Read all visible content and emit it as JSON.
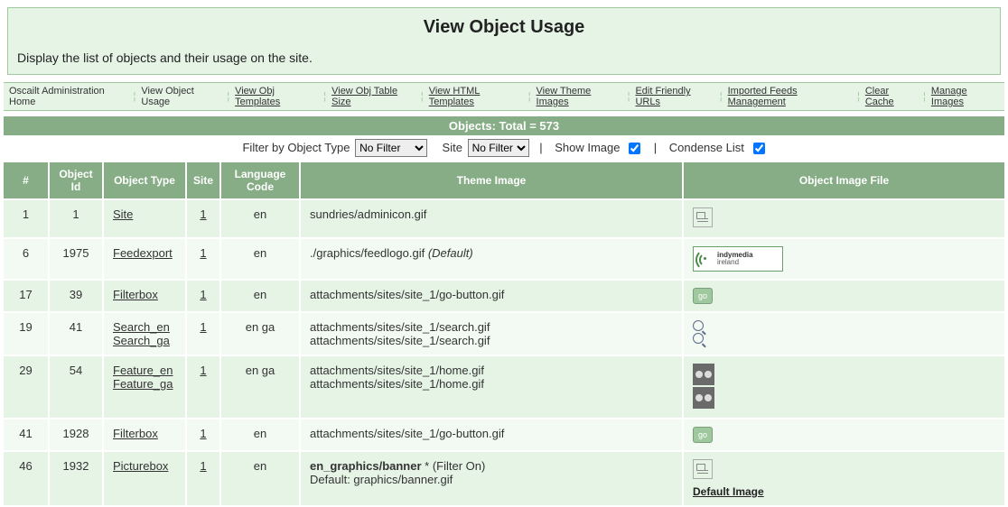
{
  "header": {
    "title": "View Object Usage",
    "description": "Display the list of objects and their usage on the site."
  },
  "nav": [
    "Oscailt Administration Home",
    "View Object Usage",
    "View Obj Templates",
    "View Obj Table Size",
    "View HTML Templates",
    "View Theme Images",
    "Edit Friendly URLs",
    "Imported Feeds Management",
    "Clear Cache",
    "Manage Images"
  ],
  "objects_bar": "Objects: Total = 573",
  "filter": {
    "label_filter": "Filter by Object Type",
    "filter_options": [
      "No Filter"
    ],
    "label_site": "Site",
    "site_options": [
      "No Filter"
    ],
    "label_show_image": "Show Image",
    "label_condense": "Condense List"
  },
  "columns": [
    "#",
    "Object Id",
    "Object Type",
    "Site",
    "Language Code",
    "Theme Image",
    "Object Image File"
  ],
  "rows": [
    {
      "num": "1",
      "obj_id": "1",
      "type_links": [
        "Site"
      ],
      "site": "1",
      "lang": "en",
      "theme_lines": [
        {
          "text": "sundries/adminicon.gif"
        }
      ],
      "img_kind": "admin-icon"
    },
    {
      "num": "6",
      "obj_id": "1975",
      "type_links": [
        "Feedexport"
      ],
      "site": "1",
      "lang": "en",
      "theme_lines": [
        {
          "text": "./graphics/feedlogo.gif ",
          "suffix_italic": "(Default)"
        }
      ],
      "img_kind": "indymedia"
    },
    {
      "num": "17",
      "obj_id": "39",
      "type_links": [
        "Filterbox"
      ],
      "site": "1",
      "lang": "en",
      "theme_lines": [
        {
          "text": "attachments/sites/site_1/go-button.gif"
        }
      ],
      "img_kind": "go"
    },
    {
      "num": "19",
      "obj_id": "41",
      "type_links": [
        "Search_en",
        "Search_ga"
      ],
      "site": "1",
      "lang": "en ga",
      "theme_lines": [
        {
          "text": "attachments/sites/site_1/search.gif"
        },
        {
          "text": "attachments/sites/site_1/search.gif"
        }
      ],
      "img_kind": "magnify2"
    },
    {
      "num": "29",
      "obj_id": "54",
      "type_links": [
        "Feature_en",
        "Feature_ga"
      ],
      "site": "1",
      "lang": "en ga",
      "theme_lines": [
        {
          "text": "attachments/sites/site_1/home.gif"
        },
        {
          "text": "attachments/sites/site_1/home.gif"
        }
      ],
      "img_kind": "feature2"
    },
    {
      "num": "41",
      "obj_id": "1928",
      "type_links": [
        "Filterbox"
      ],
      "site": "1",
      "lang": "en",
      "theme_lines": [
        {
          "text": "attachments/sites/site_1/go-button.gif"
        }
      ],
      "img_kind": "go"
    },
    {
      "num": "46",
      "obj_id": "1932",
      "type_links": [
        "Picturebox"
      ],
      "site": "1",
      "lang": "en",
      "theme_lines": [
        {
          "bold_prefix": "en_graphics/banner",
          "text": " * (Filter On)"
        },
        {
          "text": "Default: graphics/banner.gif"
        }
      ],
      "img_kind": "picture-default"
    }
  ],
  "default_image_label": "Default Image",
  "indymedia_top": "indymedia",
  "indymedia_bottom": "ireland",
  "go_label": "go"
}
